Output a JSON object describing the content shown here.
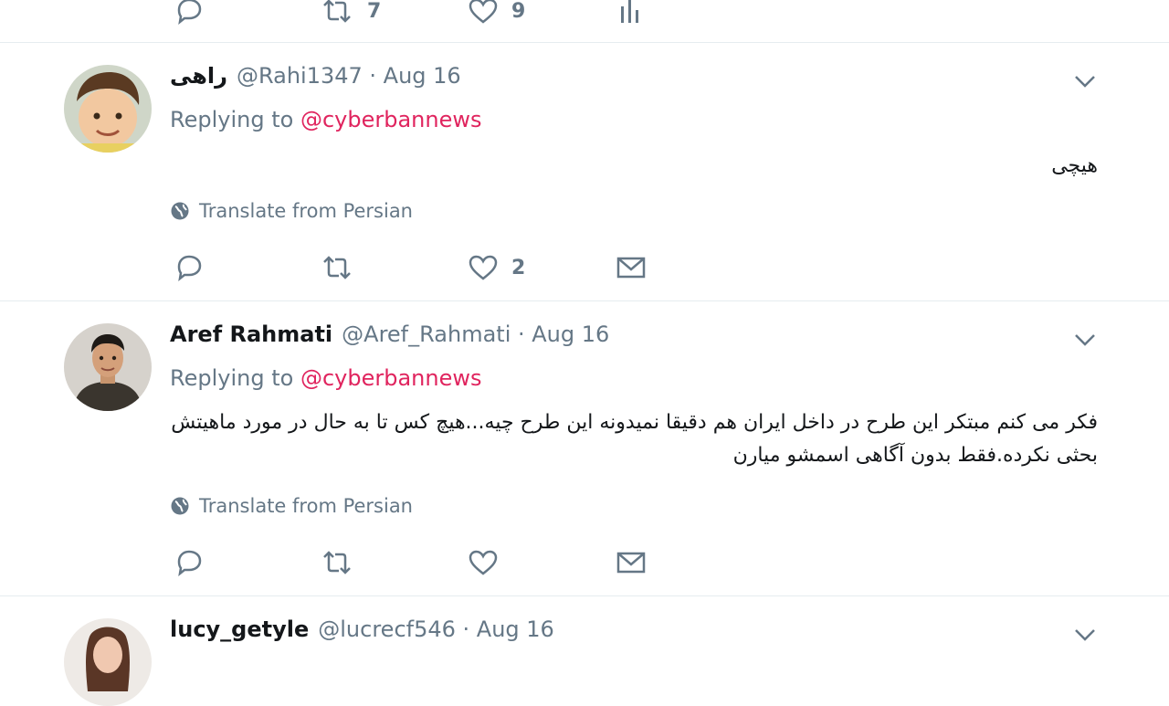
{
  "top_tweet": {
    "retweet_count": "7",
    "like_count": "9"
  },
  "tweets": [
    {
      "fullname": "راهی",
      "meta": "@Rahi1347 · Aug 16",
      "replying_prefix": "Replying to",
      "replying_handle": "@cyberbannews",
      "text": "هیچی",
      "translate": "Translate from Persian",
      "reply_count": "",
      "retweet_count": "",
      "like_count": "2"
    },
    {
      "fullname": "Aref Rahmati",
      "meta": "@Aref_Rahmati · Aug 16",
      "replying_prefix": "Replying to",
      "replying_handle": "@cyberbannews",
      "text": "فکر می کنم مبتکر این طرح در داخل ایران هم دقیقا نمیدونه این طرح چیه...هیچ کس تا به حال در مورد ماهیتش بحثی نکرده.فقط بدون آگاهی اسمشو میارن",
      "translate": "Translate from Persian",
      "like_count": ""
    },
    {
      "fullname": "lucy_getyle",
      "meta": "@lucrecf546 · Aug 16"
    }
  ],
  "icons": {
    "reply": "reply-icon",
    "retweet": "retweet-icon",
    "like": "heart-icon",
    "analytics": "analytics-icon",
    "dm": "envelope-icon",
    "more": "chevron-down-icon",
    "globe": "globe-icon"
  },
  "colors": {
    "accent_mention": "#e0245e",
    "secondary_text": "#657786",
    "divider": "#e6ecf0",
    "icon": "#657786"
  }
}
